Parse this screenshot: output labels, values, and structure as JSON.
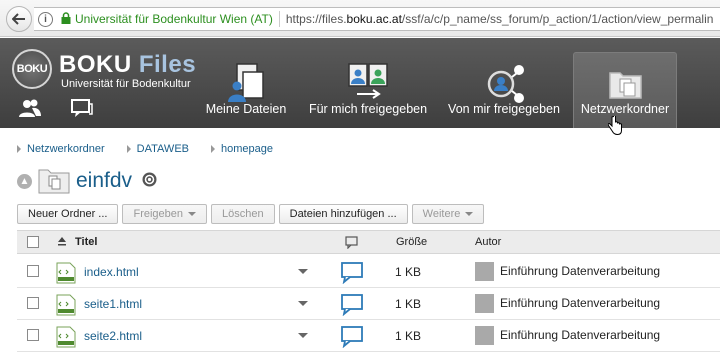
{
  "browser": {
    "site_identity": "Universität für Bodenkultur Wien (AT)",
    "url_prefix": "https://files.",
    "url_host": "boku.ac.at",
    "url_path": "/ssf/a/c/p_name/ss_forum/p_action/1/action/view_permalin"
  },
  "brand": {
    "logo_text": "BOKU",
    "title_main": "BOKU",
    "title_accent": "Files",
    "subtitle": "Universität für Bodenkultur"
  },
  "nav": [
    {
      "label": "Meine Dateien",
      "icon": "my-files-icon"
    },
    {
      "label": "Für mich freigegeben",
      "icon": "shared-with-me-icon"
    },
    {
      "label": "Von mir freigegeben",
      "icon": "shared-by-me-icon"
    },
    {
      "label": "Netzwerkordner",
      "icon": "network-folder-icon",
      "active": true
    }
  ],
  "breadcrumb": [
    "Netzwerkordner",
    "DATAWEB",
    "homepage"
  ],
  "folder": {
    "title": "einfdv"
  },
  "toolbar": {
    "new_folder": "Neuer Ordner ...",
    "share": "Freigeben",
    "delete": "Löschen",
    "add_files": "Dateien hinzufügen ...",
    "more": "Weitere"
  },
  "table": {
    "col_title": "Titel",
    "col_size": "Größe",
    "col_author": "Autor",
    "rows": [
      {
        "name": "index.html",
        "size": "1 KB",
        "author": "Einführung Datenverarbeitung"
      },
      {
        "name": "seite1.html",
        "size": "1 KB",
        "author": "Einführung Datenverarbeitung"
      },
      {
        "name": "seite2.html",
        "size": "1 KB",
        "author": "Einführung Datenverarbeitung"
      }
    ]
  },
  "colors": {
    "accent": "#1a5e8a",
    "header_bg": "#4a4a4a",
    "secure_green": "#2c8f1f"
  }
}
